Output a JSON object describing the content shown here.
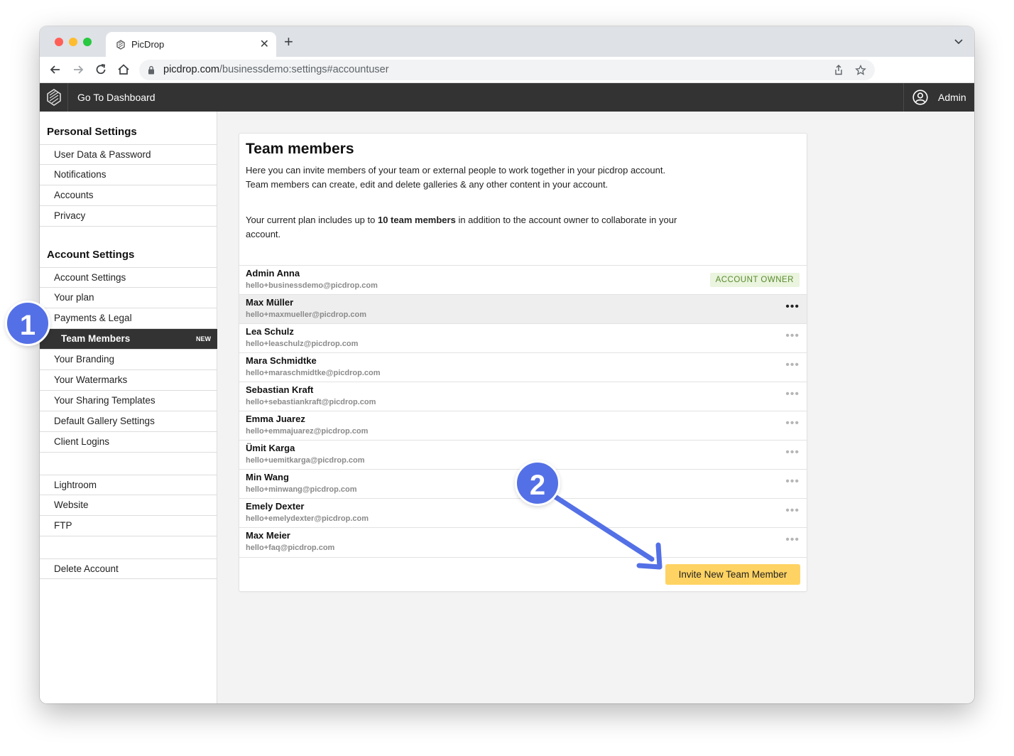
{
  "browser": {
    "tab_title": "PicDrop",
    "url_host": "picdrop.com",
    "url_path": "/businessdemo:settings#accountuser"
  },
  "appbar": {
    "dashboard_link": "Go To Dashboard",
    "admin_label": "Admin"
  },
  "sidebar": {
    "personal_title": "Personal Settings",
    "personal_items": [
      "User Data & Password",
      "Notifications",
      "Accounts",
      "Privacy"
    ],
    "account_title": "Account Settings",
    "account_items": [
      "Account Settings",
      "Your plan",
      "Payments & Legal",
      "Team Members",
      "Your Branding",
      "Your Watermarks",
      "Your Sharing Templates",
      "Default Gallery Settings",
      "Client Logins"
    ],
    "active_badge": "NEW",
    "integration_items": [
      "Lightroom",
      "Website",
      "FTP"
    ],
    "danger_items": [
      "Delete Account"
    ]
  },
  "card": {
    "title": "Team members",
    "intro": "Here you can invite members of your team or external people to work together in your picdrop account. Team members can create, edit and delete galleries & any other content in your account.",
    "plan_prefix": "Your current plan includes up to ",
    "plan_bold": "10 team members",
    "plan_suffix": " in addition to the account owner to collaborate in your account.",
    "owner_badge": "ACCOUNT OWNER",
    "menu_glyph": "•••",
    "invite_button": "Invite New Team Member",
    "members": [
      {
        "name": "Admin Anna",
        "email": "hello+businessdemo@picdrop.com"
      },
      {
        "name": "Max Müller",
        "email": "hello+maxmueller@picdrop.com"
      },
      {
        "name": "Lea Schulz",
        "email": "hello+leaschulz@picdrop.com"
      },
      {
        "name": "Mara Schmidtke",
        "email": "hello+maraschmidtke@picdrop.com"
      },
      {
        "name": "Sebastian Kraft",
        "email": "hello+sebastiankraft@picdrop.com"
      },
      {
        "name": "Emma Juarez",
        "email": "hello+emmajuarez@picdrop.com"
      },
      {
        "name": "Ümit Karga",
        "email": "hello+uemitkarga@picdrop.com"
      },
      {
        "name": "Min Wang",
        "email": "hello+minwang@picdrop.com"
      },
      {
        "name": "Emely Dexter",
        "email": "hello+emelydexter@picdrop.com"
      },
      {
        "name": "Max Meier",
        "email": "hello+faq@picdrop.com"
      }
    ]
  },
  "annotations": {
    "step1": "1",
    "step2": "2",
    "accent_color": "#5470e6"
  }
}
